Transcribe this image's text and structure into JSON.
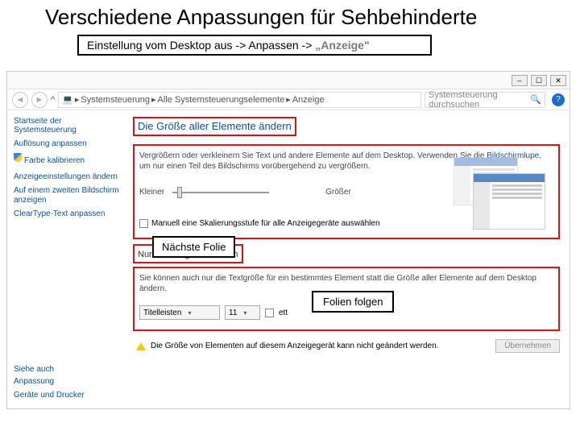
{
  "title": "Verschiedene Anpassungen für Sehbehinderte",
  "instr": {
    "pre": "Einstellung vom Desktop aus -> Anpassen -> ",
    "link": "„Anzeige\""
  },
  "winbtns": {
    "min": "–",
    "max": "☐",
    "close": "✕"
  },
  "nav": {
    "icon": "💻",
    "a": "Systemsteuerung",
    "b": "Alle Systemsteuerungselemente",
    "c": "Anzeige"
  },
  "search": {
    "ph": "Systemsteuerung durchsuchen",
    "icon": "🔍"
  },
  "help": "?",
  "side": {
    "hdr": "Startseite der Systemsteuerung",
    "links": [
      "Auflösung anpassen",
      "Farbe kalibrieren",
      "Anzeigeeinstellungen ändern",
      "Auf einem zweiten Bildschirm anzeigen",
      "ClearType-Text anpassen"
    ],
    "see_hdr": "Siehe auch",
    "see": [
      "Anpassung",
      "Geräte und Drucker"
    ]
  },
  "main": {
    "h1": "Die Größe aller Elemente ändern",
    "p1a": "Vergrößern oder verkleinern Sie Text und andere Elemente auf dem Desktop. Verwenden Sie die ",
    "p1b": "Bildschirmlupe",
    "p1c": ", um nur einen Teil des Bildschirms vorübergehend zu vergrößern.",
    "sl_small": "Kleiner",
    "sl_big": "Größer",
    "chk": "Manuell eine Skalierungsstufe für alle Anzeigegeräte auswählen",
    "h2": "Nur die Textgröße ändern",
    "p2": "Sie können auch nur die Textgröße für ein bestimmtes Element statt die Größe aller Elemente auf dem Desktop ändern.",
    "dd1": "Titelleisten",
    "dd2": "11",
    "fett": "ett",
    "warn": "Die Größe von Elementen auf diesem Anzeigegerät kann nicht geändert werden.",
    "apply": "Übernehmen"
  },
  "btns": {
    "next": "Nächste Folie",
    "folien": "Folien folgen"
  }
}
